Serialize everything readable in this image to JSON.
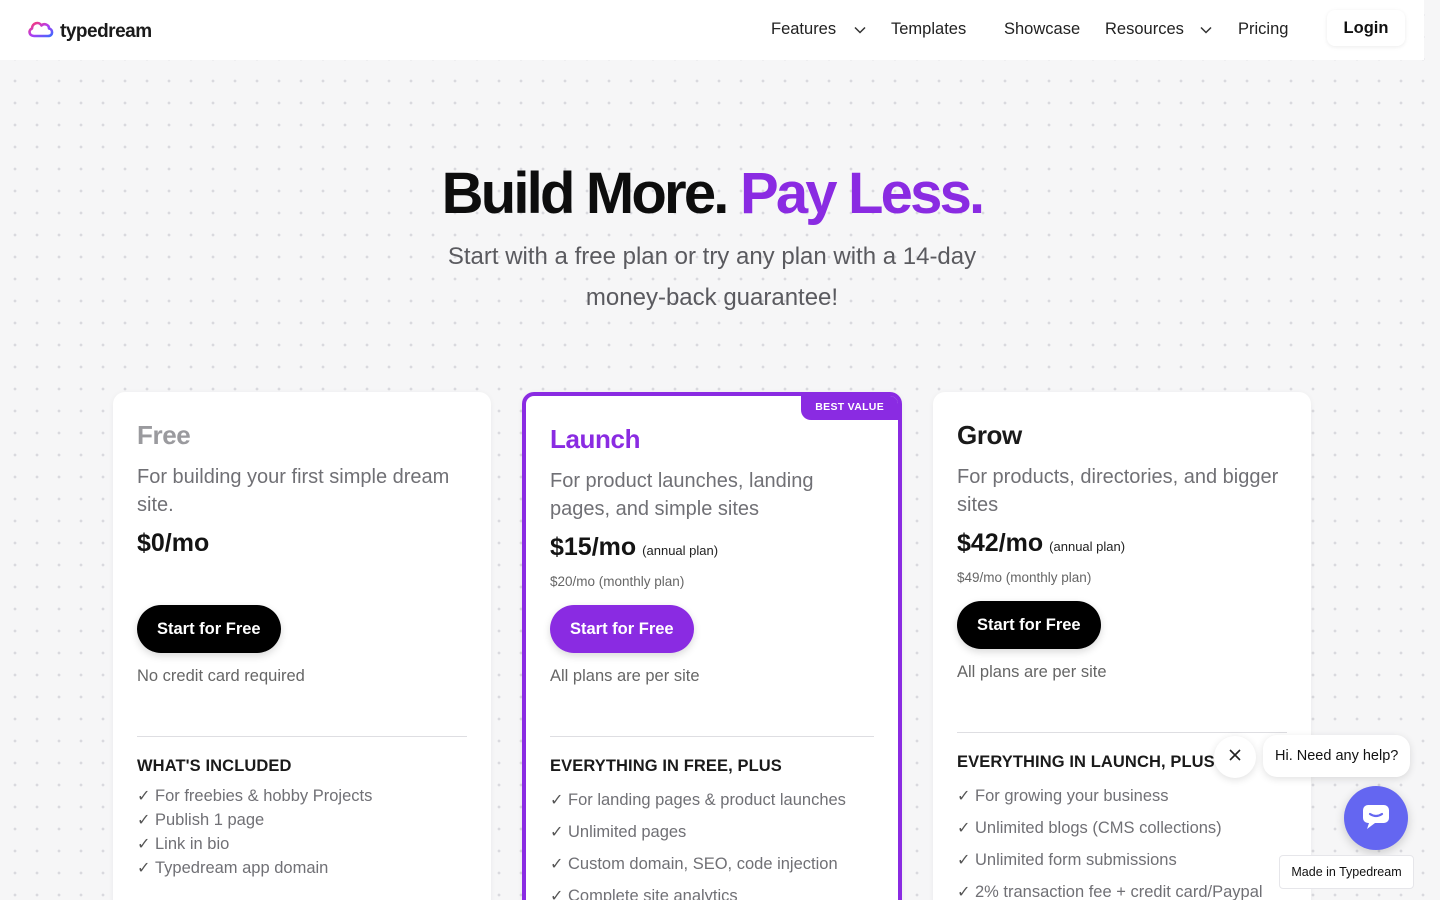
{
  "nav": {
    "logo_text": "typedream",
    "items": [
      "Features",
      "Templates",
      "Showcase",
      "Resources",
      "Pricing"
    ],
    "login": "Login"
  },
  "hero": {
    "title_main": "Build More.",
    "title_accent": "Pay Less.",
    "subtitle": "Start with a free plan or try any plan with a 14-day money-back guarantee!"
  },
  "plans": [
    {
      "name": "Free",
      "description": "For building your first simple dream site.",
      "price": "$0/mo",
      "cta": "Start for Free",
      "cta_note": "No credit card required",
      "included_heading": "WHAT'S INCLUDED",
      "features": [
        "For freebies & hobby Projects",
        "Publish 1 page",
        "Link in bio",
        "Typedream app domain"
      ]
    },
    {
      "name": "Launch",
      "badge": "BEST VALUE",
      "description": "For product launches, landing pages, and simple sites",
      "price": "$15/mo",
      "price_note": "(annual plan)",
      "monthly": "$20/mo (monthly plan)",
      "cta": "Start for Free",
      "cta_note": "All plans are per site",
      "included_heading": "EVERYTHING IN FREE, PLUS",
      "features": [
        "For landing pages & product launches",
        "Unlimited pages",
        "Custom domain, SEO, code injection",
        "Complete site analytics"
      ]
    },
    {
      "name": "Grow",
      "description": "For products, directories, and bigger sites",
      "price": "$42/mo",
      "price_note": "(annual plan)",
      "monthly": "$49/mo (monthly plan)",
      "cta": "Start for Free",
      "cta_note": "All plans are per site",
      "included_heading": "EVERYTHING IN LAUNCH, PLUS",
      "features": [
        "For growing your business",
        "Unlimited blogs (CMS collections)",
        "Unlimited form submissions",
        "2% transaction fee + credit card/Paypal"
      ]
    }
  ],
  "chat": {
    "greeting": "Hi. Need any help?"
  },
  "footer_badge": "Made in Typedream",
  "colors": {
    "accent": "#8a2be2",
    "chat": "#6466f1"
  }
}
